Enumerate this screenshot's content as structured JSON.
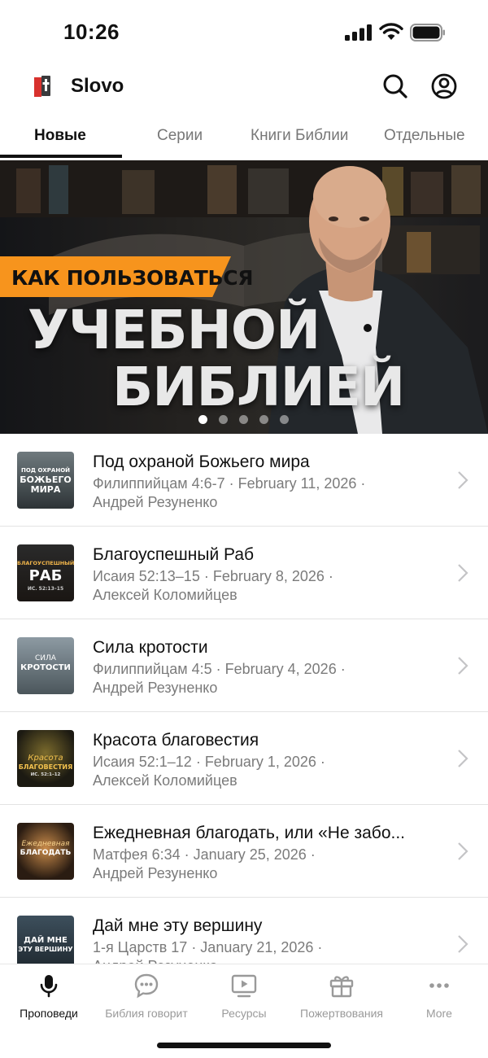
{
  "status_bar": {
    "time": "10:26"
  },
  "app": {
    "title": "Slovo"
  },
  "tabs": [
    {
      "label": "Новые",
      "active": true
    },
    {
      "label": "Серии",
      "active": false
    },
    {
      "label": "Книги Библии",
      "active": false
    },
    {
      "label": "Отдельные",
      "active": false
    }
  ],
  "banner": {
    "tag": "КАК ПОЛЬЗОВАТЬСЯ",
    "line1": "УЧЕБНОЙ",
    "line2": "БИБЛИЕЙ",
    "pages": 5,
    "active_page": 1,
    "accent_color": "#f7941d"
  },
  "sermons": [
    {
      "title": "Под охраной Божьего мира",
      "meta": "Филиппийцам 4:6-7 · February 11, 2026 ·",
      "author": "Андрей Резуненко",
      "thumb_text": [
        "ПОД ОХРАНОЙ",
        "БОЖЬЕГО",
        "МИРА"
      ]
    },
    {
      "title": "Благоуспешный Раб",
      "meta": "Исаия 52:13–15 · February 8, 2026 ·",
      "author": "Алексей Коломийцев",
      "thumb_text": [
        "БЛАГОУСПЕШНЫЙ",
        "РАБ",
        "ИС. 52:13–15"
      ]
    },
    {
      "title": "Сила кротости",
      "meta": "Филиппийцам 4:5 · February 4, 2026 ·",
      "author": "Андрей Резуненко",
      "thumb_text": [
        "СИЛА",
        "КРОТОСТИ"
      ]
    },
    {
      "title": "Красота благовестия",
      "meta": "Исаия 52:1–12 · February 1, 2026 ·",
      "author": "Алексей Коломийцев",
      "thumb_text": [
        "Красота",
        "БЛАГОВЕСТИЯ",
        "ИС. 52:1–12"
      ]
    },
    {
      "title": "Ежедневная благодать, или «Не забо...",
      "meta": "Матфея 6:34 · January 25, 2026 ·",
      "author": "Андрей Резуненко",
      "thumb_text": [
        "Ежедневная",
        "БЛАГОДАТЬ"
      ]
    },
    {
      "title": "Дай мне эту вершину",
      "meta": "1-я Царств 17 · January 21, 2026 ·",
      "author": "Андрей Резуненко",
      "thumb_text": [
        "ДАЙ МНЕ",
        "ЭТУ ВЕРШИНУ"
      ]
    }
  ],
  "bottom_nav": [
    {
      "label": "Проповеди",
      "icon": "microphone-icon",
      "active": true
    },
    {
      "label": "Библия говорит",
      "icon": "speech-bubble-icon",
      "active": false
    },
    {
      "label": "Ресурсы",
      "icon": "video-screen-icon",
      "active": false
    },
    {
      "label": "Пожертвования",
      "icon": "gift-icon",
      "active": false
    },
    {
      "label": "More",
      "icon": "more-dots-icon",
      "active": false
    }
  ]
}
